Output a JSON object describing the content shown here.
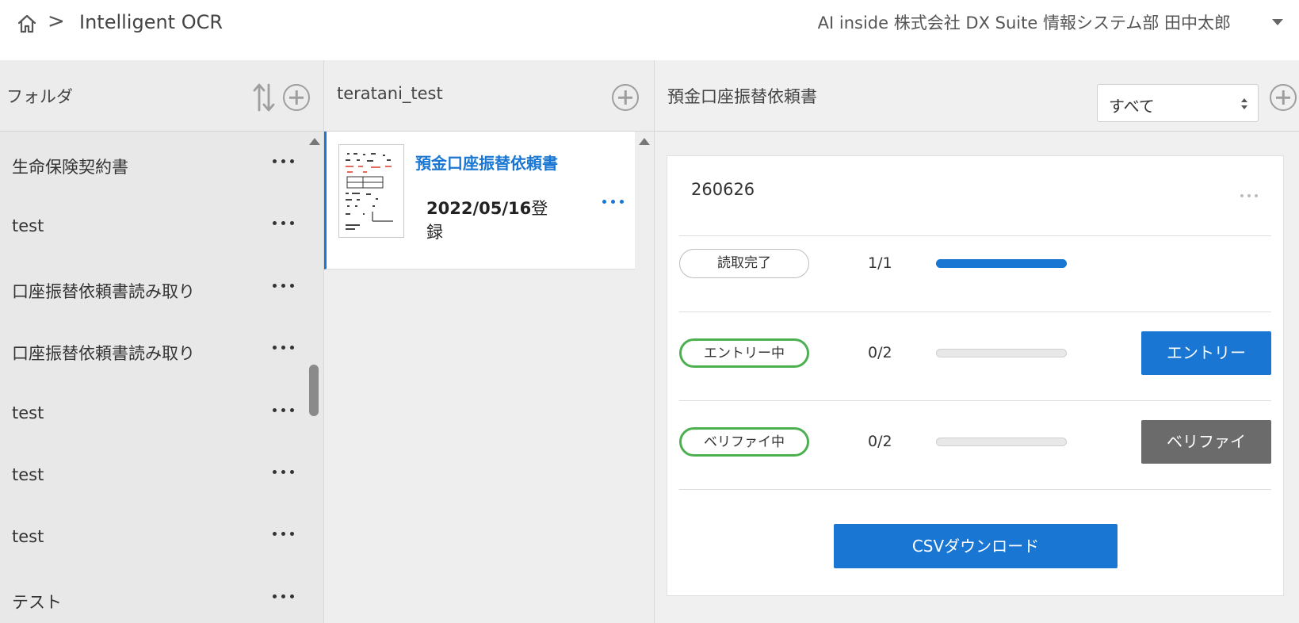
{
  "header": {
    "breadcrumb_separator": ">",
    "title": "Intelligent OCR",
    "user": "AI inside 株式会社 DX Suite 情報システム部 田中太郎"
  },
  "folders": {
    "title": "フォルダ",
    "items": [
      {
        "label": "生命保険契約書"
      },
      {
        "label": "test"
      },
      {
        "label": "口座振替依頼書読み取り"
      },
      {
        "label": "口座振替依頼書読み取り"
      },
      {
        "label": "test"
      },
      {
        "label": "test"
      },
      {
        "label": "test"
      },
      {
        "label": "テスト"
      }
    ]
  },
  "documents": {
    "title": "teratani_test",
    "items": [
      {
        "title": "預金口座振替依頼書",
        "date": "2022/05/16",
        "date_suffix": "登録"
      }
    ]
  },
  "detail": {
    "title": "預金口座振替依頼書",
    "filter": "すべて",
    "job_id": "260626",
    "rows": [
      {
        "status": "読取完了",
        "count": "1/1",
        "progress": 1.0,
        "action": null,
        "style": "gray"
      },
      {
        "status": "エントリー中",
        "count": "0/2",
        "progress": 0.0,
        "action": "エントリー",
        "style": "green"
      },
      {
        "status": "ベリファイ中",
        "count": "0/2",
        "progress": 0.0,
        "action": "ベリファイ",
        "style": "green"
      }
    ],
    "csv_button": "CSVダウンロード"
  },
  "colors": {
    "accent": "#1976d2",
    "status_green": "#4caf50",
    "verify_button": "#6b6b6b"
  }
}
